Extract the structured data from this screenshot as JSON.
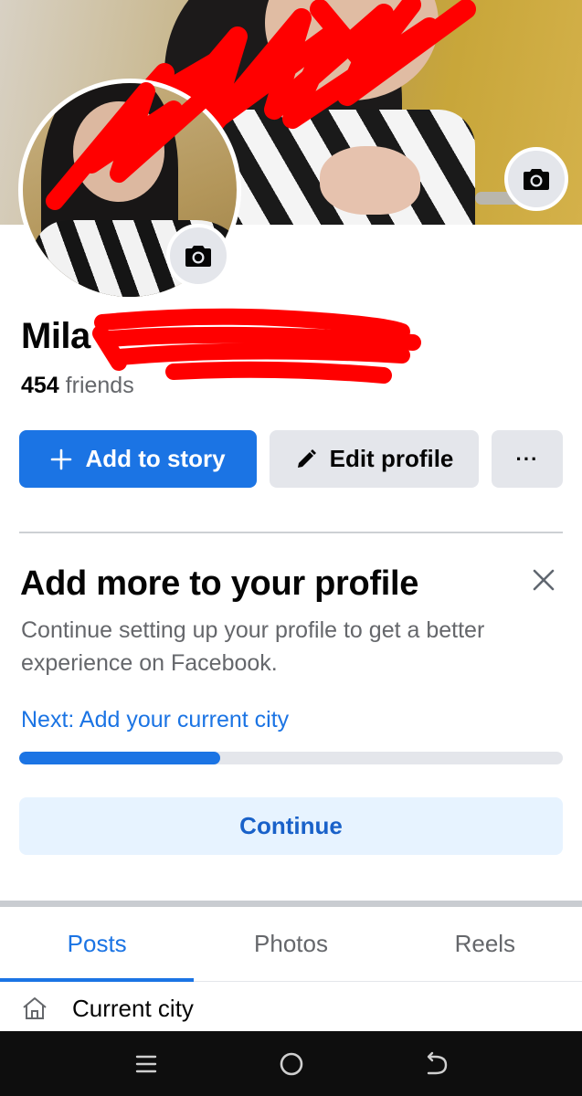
{
  "profile": {
    "name_visible": "Mila",
    "friends_count": "454",
    "friends_label": "friends"
  },
  "actions": {
    "add_story_label": "Add to story",
    "edit_profile_label": "Edit profile",
    "more_label": "···"
  },
  "card": {
    "title": "Add more to your profile",
    "description": "Continue setting up your profile to get a better experience on Facebook.",
    "next_step": "Next: Add your current city",
    "progress_fraction": 0.37,
    "continue_label": "Continue"
  },
  "tabs": [
    {
      "label": "Posts",
      "active": true
    },
    {
      "label": "Photos",
      "active": false
    },
    {
      "label": "Reels",
      "active": false
    }
  ],
  "about": {
    "current_city_label": "Current city",
    "icon": "home-icon"
  },
  "icons": {
    "cover_camera": "camera-icon",
    "avatar_camera": "camera-icon",
    "close": "close-icon",
    "plus": "plus-icon",
    "pencil": "pencil-icon",
    "system_menu": "menu-icon",
    "system_home": "circle-icon",
    "system_back": "back-icon"
  },
  "colors": {
    "brand": "#1b74e4",
    "secondary_bg": "#e4e6eb",
    "continue_bg": "#e7f3ff",
    "redaction": "#ff0000"
  }
}
